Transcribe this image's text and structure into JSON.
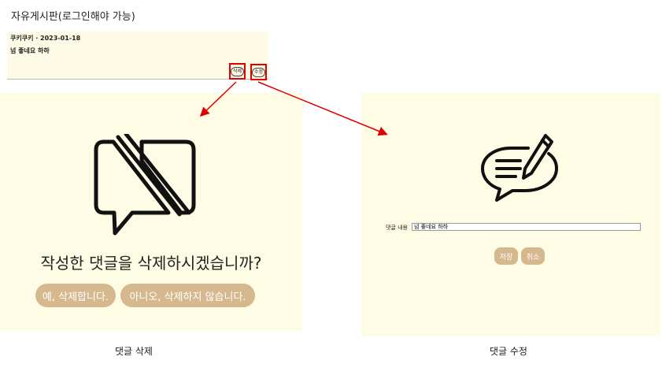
{
  "page": {
    "title": "자유게시판(로그인해야 가능)"
  },
  "comment": {
    "meta": "쿠키쿠키 · 2023-01-18",
    "text": "넘 좋네요 하하",
    "delete_label": "삭제",
    "edit_label": "수정"
  },
  "delete_dialog": {
    "icon": "message-off-icon",
    "question": "작성한 댓글을 삭제하시겠습니까?",
    "confirm_label": "예, 삭제합니다.",
    "cancel_label": "아니오, 삭제하지 않습니다.",
    "caption": "댓글 삭제"
  },
  "edit_dialog": {
    "icon": "message-edit-icon",
    "field_label": "댓글 내용",
    "field_value": "넘 좋네요 하하",
    "save_label": "저장",
    "cancel_label": "취소",
    "caption": "댓글 수정"
  },
  "colors": {
    "button": "#d6b88e",
    "panel": "#fefce4",
    "annotation": "#e00000"
  }
}
